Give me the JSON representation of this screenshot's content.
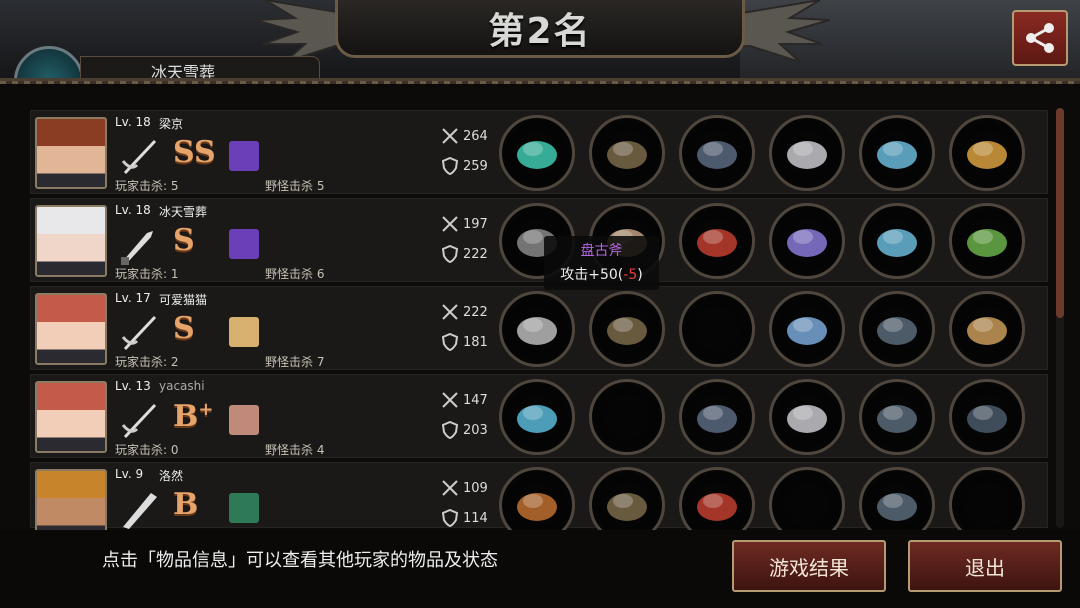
{
  "header": {
    "title": "第2名",
    "share_icon": "share-icon"
  },
  "top_player": {
    "name": "冰天雪葬"
  },
  "players": [
    {
      "level": "Lv. 18",
      "name": "梁京",
      "rank": "SS",
      "rank_sup": "",
      "player_kills": "玩家击杀: 5",
      "monster_kills": "野怪击杀 5",
      "attack": "264",
      "defense": "259",
      "weapon_icon": "rapier-icon",
      "skill_color": "#6b3fb8",
      "hair": "#8a3d22",
      "skin": "#e2b596"
    },
    {
      "level": "Lv. 18",
      "name": "冰天雪葬",
      "rank": "S",
      "rank_sup": "",
      "player_kills": "玩家击杀: 1",
      "monster_kills": "野怪击杀 6",
      "attack": "197",
      "defense": "222",
      "weapon_icon": "knife-icon",
      "skill_color": "#6b3fb8",
      "hair": "#e8e8ea",
      "skin": "#f0d6c8"
    },
    {
      "level": "Lv. 17",
      "name": "可爱猫猫",
      "rank": "S",
      "rank_sup": "",
      "player_kills": "玩家击杀: 2",
      "monster_kills": "野怪击杀 7",
      "attack": "222",
      "defense": "181",
      "weapon_icon": "rapier-icon",
      "skill_color": "#d8b070",
      "hair": "#c45a4a",
      "skin": "#f2cdb8"
    },
    {
      "level": "Lv. 13",
      "name": "yacashi",
      "rank": "B",
      "rank_sup": "+",
      "player_kills": "玩家击杀: 0",
      "monster_kills": "野怪击杀 4",
      "attack": "147",
      "defense": "203",
      "weapon_icon": "rapier-icon",
      "skill_color": "#c08a7a",
      "hair": "#c45a4a",
      "skin": "#f2cdb8"
    },
    {
      "level": "Lv. 9",
      "name": "洛然",
      "rank": "B",
      "rank_sup": "",
      "player_kills": "",
      "monster_kills": "",
      "attack": "109",
      "defense": "114",
      "weapon_icon": "bat-icon",
      "skill_color": "#2f7a56",
      "hair": "#c8842a",
      "skin": "#c08a64"
    }
  ],
  "tooltip": {
    "item_name": "盘古斧",
    "stat_prefix": "攻击+50(",
    "stat_negative": "-5",
    "stat_suffix": ")"
  },
  "footer": {
    "hint": "点击「物品信息」可以查看其他玩家的物品及状态",
    "result_button": "游戏结果",
    "exit_button": "退出"
  },
  "colors": {
    "accent": "#6e2a22",
    "rank": "#e7a46a",
    "tooltip_name": "#b266e0",
    "negative": "#e24040"
  }
}
